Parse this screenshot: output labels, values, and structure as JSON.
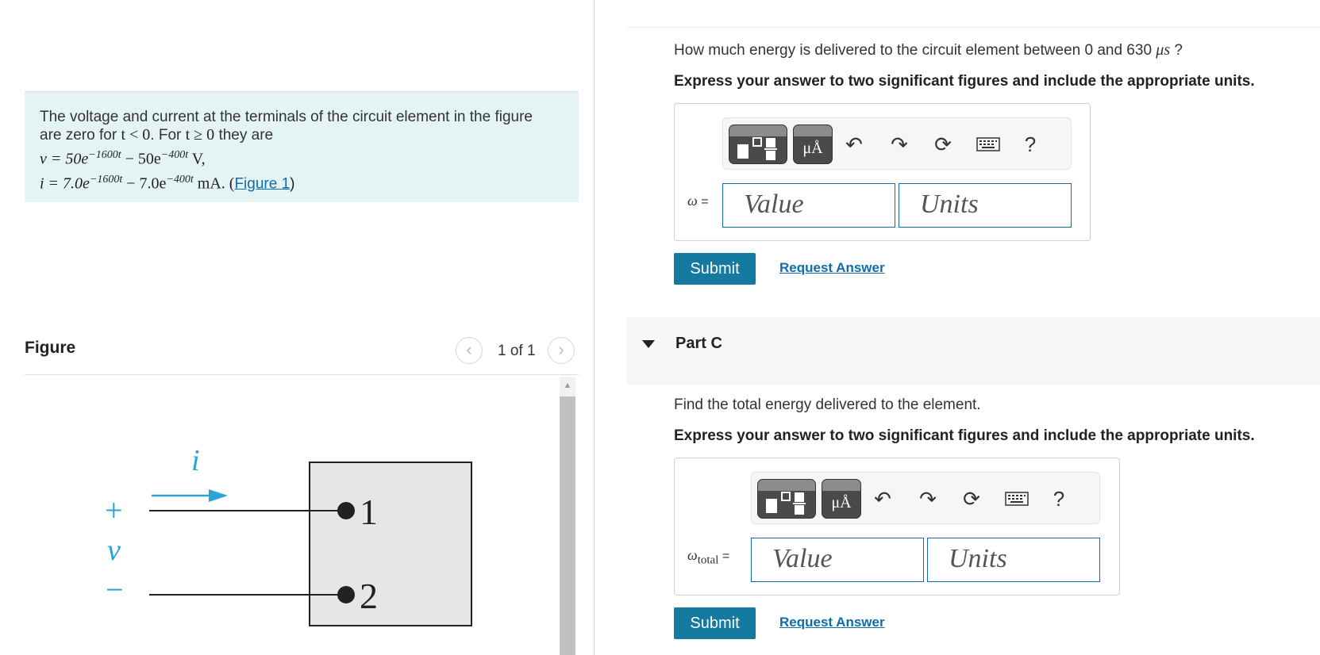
{
  "problem": {
    "line1": "The voltage and current at the terminals of the circuit element in the figure",
    "line2_pre": "are zero for ",
    "line2_cond1": "t < 0",
    "line2_mid": ". For ",
    "line2_cond2": "t ≥ 0",
    "line2_post": " they are",
    "v_lhs": "v = 50e",
    "v_exp1": "−1600t",
    "v_mid": " − 50e",
    "v_exp2": "−400t",
    "v_unit": " V,",
    "i_lhs": "i = 7.0e",
    "i_exp1": "−1600t",
    "i_mid": " − 7.0e",
    "i_exp2": "−400t",
    "i_unit": " mA. (",
    "figure_link": "Figure 1",
    "i_close": ")"
  },
  "figure": {
    "title": "Figure",
    "page_indicator": "1 of 1",
    "prev_icon": "chevron-left-icon",
    "next_icon": "chevron-right-icon",
    "current_label": "i",
    "plus": "+",
    "voltage_label": "v",
    "minus": "−",
    "terminal1": "1",
    "terminal2": "2"
  },
  "partB": {
    "question_pre": "How much energy is delivered to the circuit element between 0 and 630 ",
    "question_unit": "μs",
    "question_post": " ?",
    "instruction": "Express your answer to two significant figures and include the appropriate units.",
    "symbol": "ω",
    "symbol_eq": " =",
    "value_placeholder": "Value",
    "units_placeholder": "Units",
    "submit": "Submit",
    "request": "Request Answer"
  },
  "partC": {
    "title": "Part C",
    "question": "Find the total energy delivered to the element.",
    "instruction": "Express your answer to two significant figures and include the appropriate units.",
    "symbol": "ω",
    "symbol_sub": "total",
    "symbol_eq": " =",
    "value_placeholder": "Value",
    "units_placeholder": "Units",
    "submit": "Submit",
    "request": "Request Answer"
  },
  "toolbar": {
    "units_glyph": "μÅ",
    "help": "?"
  },
  "colors": {
    "accent": "#147aa0",
    "link": "#0f6dac",
    "problem_bg": "#e4f3f3",
    "figure_blue": "#2aa3d8"
  }
}
